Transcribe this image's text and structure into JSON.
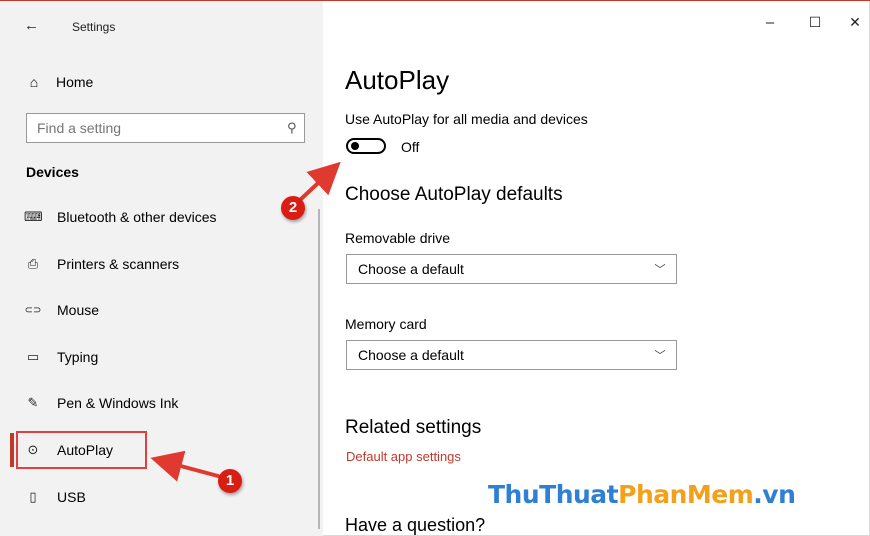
{
  "window": {
    "title": "Settings",
    "controls": {
      "minimize": "–",
      "maximize": "☐",
      "close": "✕"
    }
  },
  "sidebar": {
    "back_icon": "←",
    "home_label": "Home",
    "home_icon": "⌂",
    "search": {
      "placeholder": "Find a setting",
      "icon": "⚲"
    },
    "section_title": "Devices",
    "items": [
      {
        "label": "Bluetooth & other devices",
        "icon": "⌨"
      },
      {
        "label": "Printers & scanners",
        "icon": "⎙"
      },
      {
        "label": "Mouse",
        "icon": "⊂⊃"
      },
      {
        "label": "Typing",
        "icon": "▭"
      },
      {
        "label": "Pen & Windows Ink",
        "icon": "✎"
      },
      {
        "label": "AutoPlay",
        "icon": "⊙",
        "active": true
      },
      {
        "label": "USB",
        "icon": "▯"
      }
    ]
  },
  "main": {
    "title": "AutoPlay",
    "autoplay_toggle": {
      "label": "Use AutoPlay for all media and devices",
      "state": "Off",
      "on": false
    },
    "defaults_heading": "Choose AutoPlay defaults",
    "removable_drive": {
      "label": "Removable drive",
      "value": "Choose a default"
    },
    "memory_card": {
      "label": "Memory card",
      "value": "Choose a default"
    },
    "chevron_icon": "﹀",
    "related_heading": "Related settings",
    "related_link": "Default app settings",
    "question_heading": "Have a question?"
  },
  "annotations": {
    "step1": "1",
    "step2": "2",
    "color": "#d81e12"
  },
  "watermark": {
    "part1": "ThuThuat",
    "part2": "PhanMem",
    "part3": ".vn"
  },
  "colors": {
    "accent": "#c0392b",
    "sidebar_bg": "#f2f2f2"
  }
}
